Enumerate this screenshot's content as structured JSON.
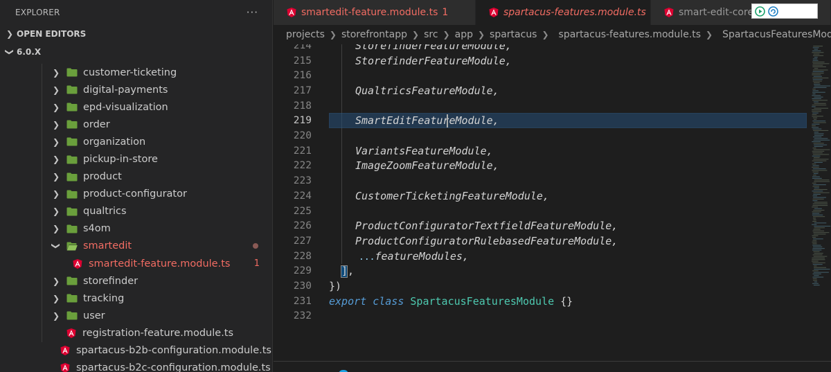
{
  "sidebar": {
    "title": "EXPLORER",
    "more_label": "···",
    "open_editors_label": "OPEN EDITORS",
    "workspace_label": "6.0.X",
    "items": [
      {
        "label": "customer-ticketing",
        "kind": "folder"
      },
      {
        "label": "digital-payments",
        "kind": "folder"
      },
      {
        "label": "epd-visualization",
        "kind": "folder"
      },
      {
        "label": "order",
        "kind": "folder"
      },
      {
        "label": "organization",
        "kind": "folder"
      },
      {
        "label": "pickup-in-store",
        "kind": "folder"
      },
      {
        "label": "product",
        "kind": "folder"
      },
      {
        "label": "product-configurator",
        "kind": "folder"
      },
      {
        "label": "qualtrics",
        "kind": "folder"
      },
      {
        "label": "s4om",
        "kind": "folder"
      },
      {
        "label": "smartedit",
        "kind": "folder-open",
        "modified": true
      },
      {
        "label": "smartedit-feature.module.ts",
        "kind": "file",
        "modified": true,
        "badge": "1"
      },
      {
        "label": "storefinder",
        "kind": "folder"
      },
      {
        "label": "tracking",
        "kind": "folder"
      },
      {
        "label": "user",
        "kind": "folder"
      },
      {
        "label": "registration-feature.module.ts",
        "kind": "file"
      },
      {
        "label": "spartacus-b2b-configuration.module.ts",
        "kind": "file"
      },
      {
        "label": "spartacus-b2c-configuration.module.ts",
        "kind": "file"
      }
    ]
  },
  "tabs": [
    {
      "label": "smartedit-feature.module.ts",
      "badge": "1"
    },
    {
      "label": "spartacus-features.module.ts",
      "close": "×"
    },
    {
      "label": "smart-edit-core"
    }
  ],
  "breadcrumb": {
    "items": [
      "projects",
      "storefrontapp",
      "src",
      "app",
      "spartacus",
      "spartacus-features.module.ts",
      "SpartacusFeaturesModule"
    ]
  },
  "code": {
    "current_line": "219",
    "lines": [
      {
        "n": "214",
        "text": "StorefinderFeatureModule,"
      },
      {
        "n": "215",
        "text": "StorefinderFeatureModule,"
      },
      {
        "n": "216",
        "text": ""
      },
      {
        "n": "217",
        "text": "QualtricsFeatureModule,"
      },
      {
        "n": "218",
        "text": ""
      },
      {
        "n": "219",
        "text": "SmartEditFeatureModule,"
      },
      {
        "n": "220",
        "text": ""
      },
      {
        "n": "221",
        "text": "VariantsFeatureModule,"
      },
      {
        "n": "222",
        "text": "ImageZoomFeatureModule,"
      },
      {
        "n": "223",
        "text": ""
      },
      {
        "n": "224",
        "text": "CustomerTicketingFeatureModule,"
      },
      {
        "n": "225",
        "text": ""
      },
      {
        "n": "226",
        "text": "ProductConfiguratorTextfieldFeatureModule,"
      },
      {
        "n": "227",
        "text": "ProductConfiguratorRulebasedFeatureModule,"
      },
      {
        "n": "228",
        "text": "...featureModules,"
      },
      {
        "n": "229",
        "text": "],"
      },
      {
        "n": "230",
        "text": "})"
      },
      {
        "n": "231",
        "text": "export class SpartacusFeaturesModule {}"
      },
      {
        "n": "232",
        "text": ""
      }
    ],
    "export_keyword": "export",
    "class_keyword": "class",
    "class_name": "SpartacusFeaturesModule",
    "class_body": " {}",
    "spread_dots": "...",
    "spread_name": "featureModules,"
  },
  "colors": {
    "angular_red": "#dd0031",
    "modified_red": "#f26c63",
    "folder_green": "#6a9f3c",
    "keyword_blue": "#569cd6",
    "class_teal": "#4ec9b0"
  }
}
